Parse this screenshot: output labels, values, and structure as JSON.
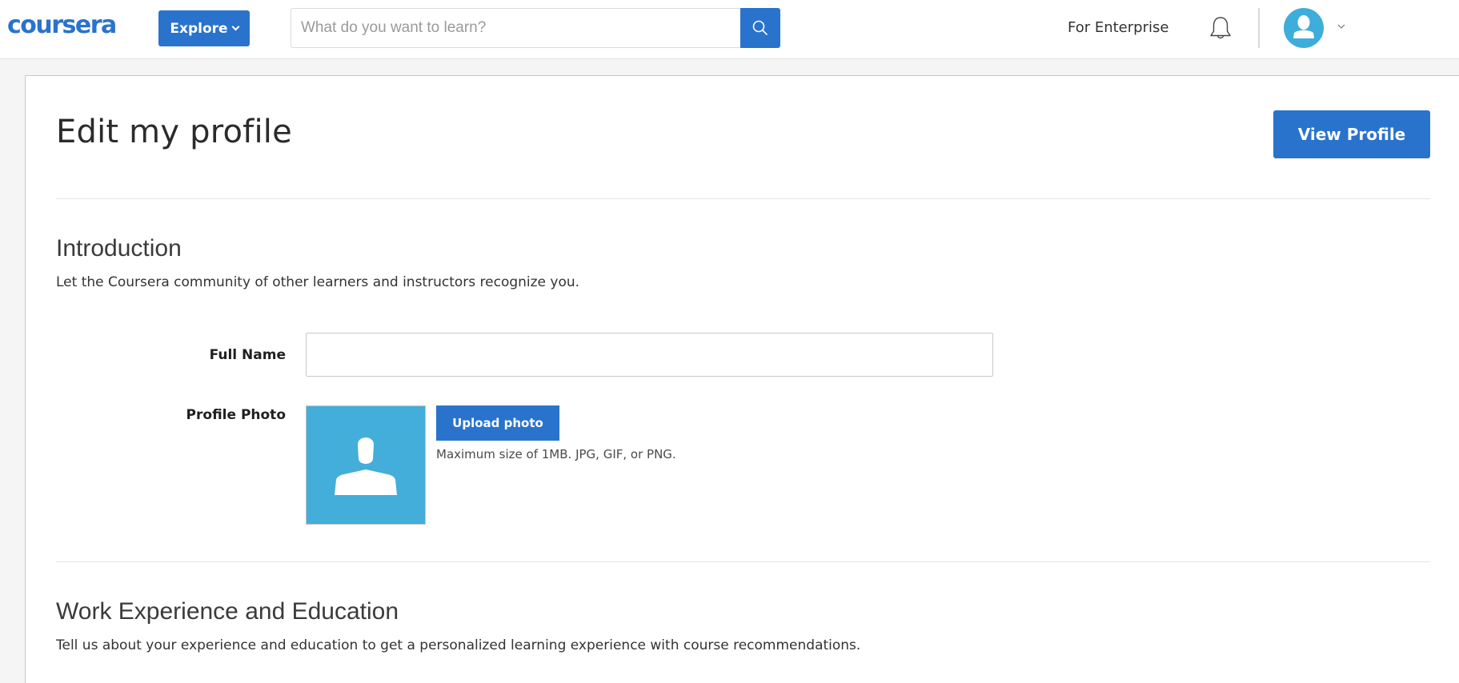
{
  "header": {
    "logo_text": "coursera",
    "explore_label": "Explore",
    "search_placeholder": "What do you want to learn?",
    "search_value": "",
    "enterprise_label": "For Enterprise",
    "icons": {
      "search": "search-icon",
      "bell": "bell-icon",
      "avatar": "user-avatar-icon",
      "chevron": "chevron-down-icon"
    }
  },
  "page": {
    "title": "Edit my profile",
    "view_profile_label": "View Profile"
  },
  "introduction": {
    "title": "Introduction",
    "description": "Let the Coursera community of other learners and instructors recognize you.",
    "full_name_label": "Full Name",
    "full_name_value": "",
    "profile_photo_label": "Profile Photo",
    "upload_label": "Upload photo",
    "upload_hint": "Maximum size of 1MB. JPG, GIF, or PNG."
  },
  "work": {
    "title": "Work Experience and Education",
    "description": "Tell us about your experience and education to get a personalized learning experience with course recommendations."
  },
  "colors": {
    "brand_blue": "#2a73cc",
    "avatar_blue": "#3eadd9"
  }
}
